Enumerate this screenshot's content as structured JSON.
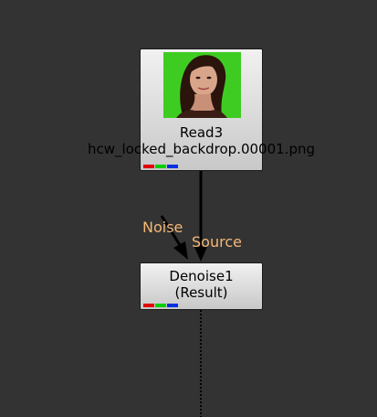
{
  "read_node": {
    "title": "Read3",
    "filename": "hcw_locked_backdrop.00001.png",
    "thumbnail_background": "#3fcc22"
  },
  "denoise_node": {
    "title": "Denoise1",
    "subtitle": "(Result)"
  },
  "inputs": {
    "noise_label": "Noise",
    "source_label": "Source"
  },
  "colors": {
    "canvas": "#333333",
    "label": "#f5b878",
    "channel_red": "#e00000",
    "channel_green": "#00d000",
    "channel_blue": "#0030e0"
  }
}
